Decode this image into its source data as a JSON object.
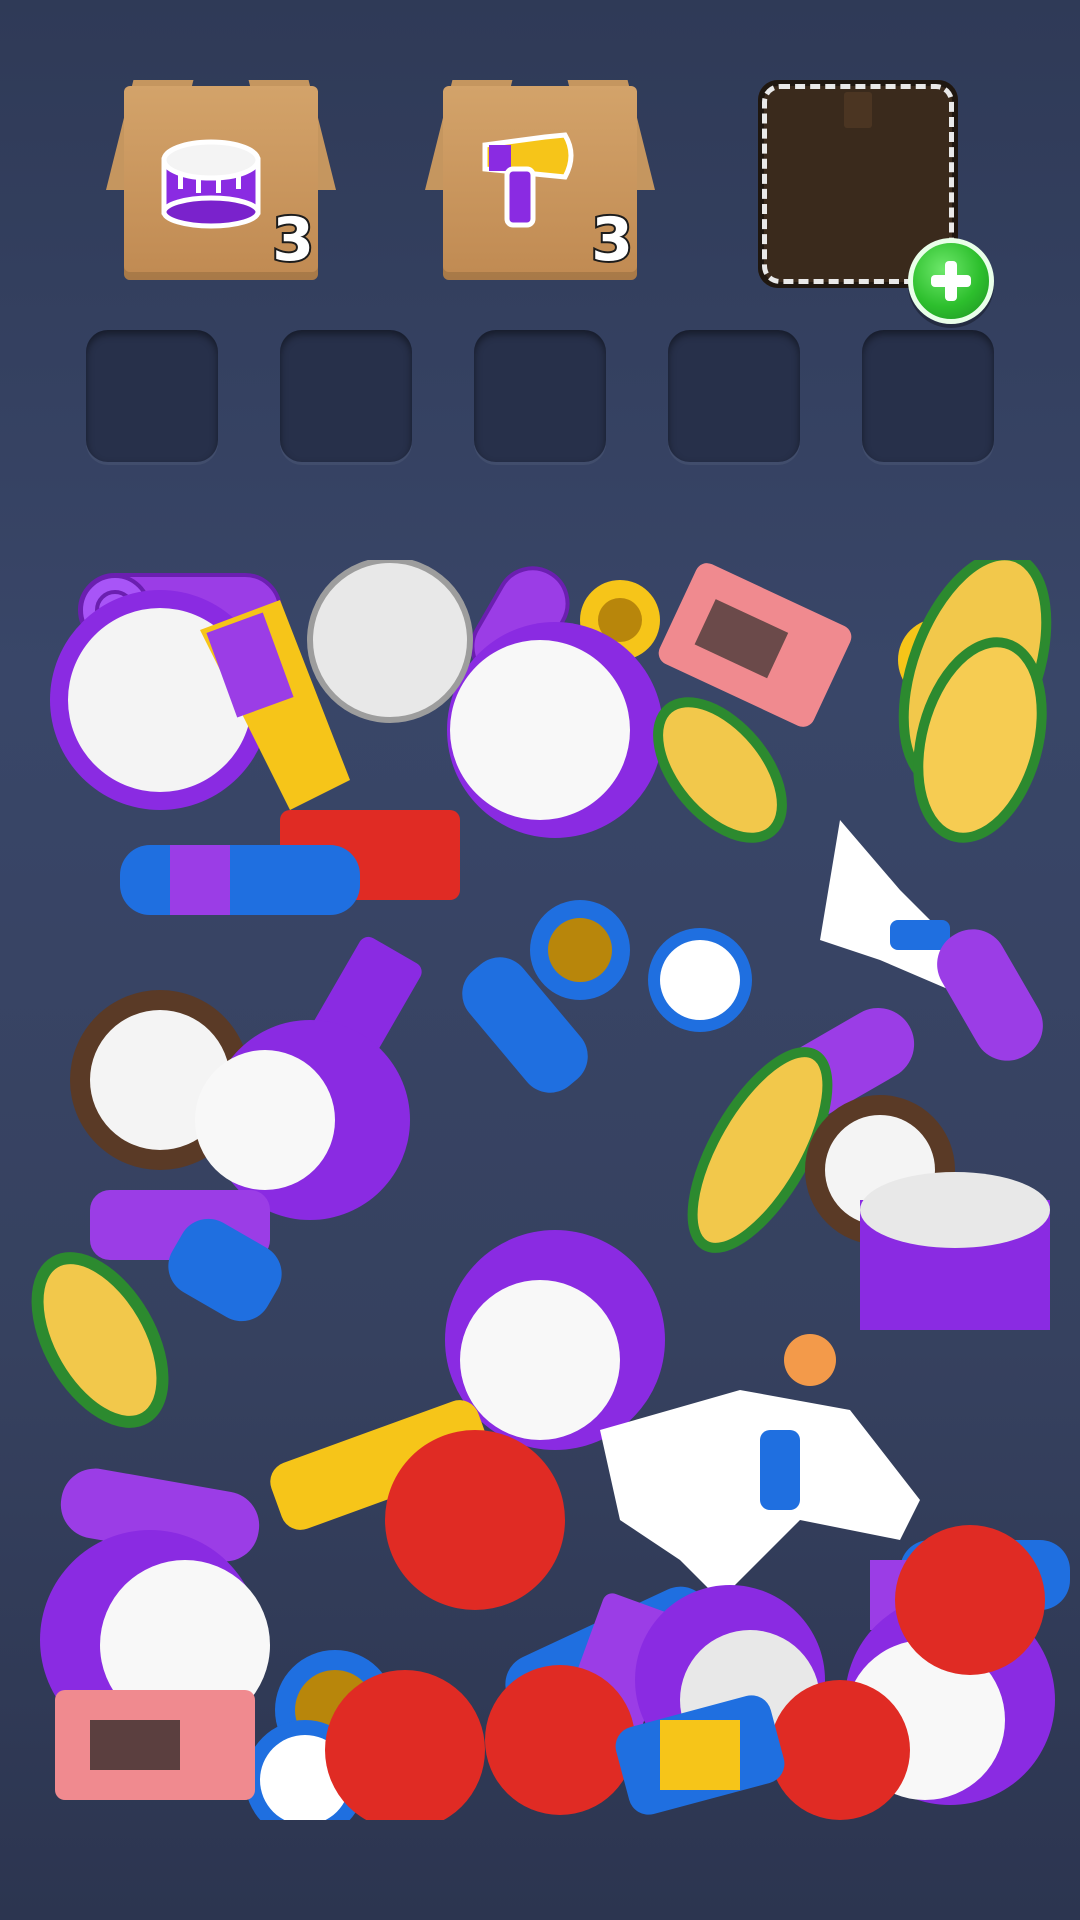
{
  "orders": [
    {
      "item": "drum",
      "count": "3"
    },
    {
      "item": "hair-dryer",
      "count": "3"
    }
  ],
  "empty_order": {
    "add_icon": "plus-icon"
  },
  "tray": {
    "slot_count": 5
  },
  "colors": {
    "purple": "#8a2be2",
    "blue": "#1f6fe0",
    "yellow": "#f6c519",
    "red": "#e02b24",
    "pink": "#f08a8f",
    "green": "#2c8a2f",
    "white": "#f2f2f2"
  }
}
